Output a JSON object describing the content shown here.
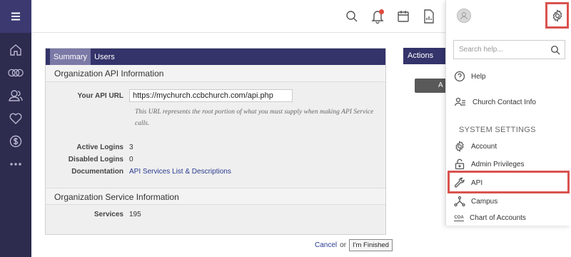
{
  "panel": {
    "tabs": [
      {
        "label": "Summary"
      },
      {
        "label": "Users"
      }
    ],
    "api_section": {
      "title": "Organization API Information",
      "api_url_label": "Your API URL",
      "api_url_value": "https://mychurch.ccbchurch.com/api.php",
      "api_url_note": "This URL represents the root portion of what you must supply when making API Service calls.",
      "active_logins_label": "Active Logins",
      "active_logins_value": "3",
      "disabled_logins_label": "Disabled Logins",
      "disabled_logins_value": "0",
      "documentation_label": "Documentation",
      "documentation_link": "API Services List & Descriptions"
    },
    "service_section": {
      "title": "Organization Service Information",
      "services_label": "Services",
      "services_value": "195"
    }
  },
  "footer": {
    "cancel": "Cancel",
    "or": "or",
    "finish": "I'm Finished"
  },
  "actions": {
    "title": "Actions",
    "button_partial": "A"
  },
  "dropdown": {
    "search_placeholder": "Search help...",
    "items": [
      {
        "label": "Help"
      },
      {
        "label": "Church Contact Info"
      }
    ],
    "system_settings_label": "SYSTEM SETTINGS",
    "settings_items": [
      {
        "label": "Account"
      },
      {
        "label": "Admin Privileges"
      },
      {
        "label": "API"
      },
      {
        "label": "Campus"
      },
      {
        "label": "Chart of Accounts"
      }
    ],
    "coa_icon_text": "COA"
  },
  "colors": {
    "sidebar_bg": "#2d2b4e",
    "tab_bar_bg": "#34336a",
    "highlight_red": "#d9534f",
    "link_blue": "#2a3b8f"
  }
}
